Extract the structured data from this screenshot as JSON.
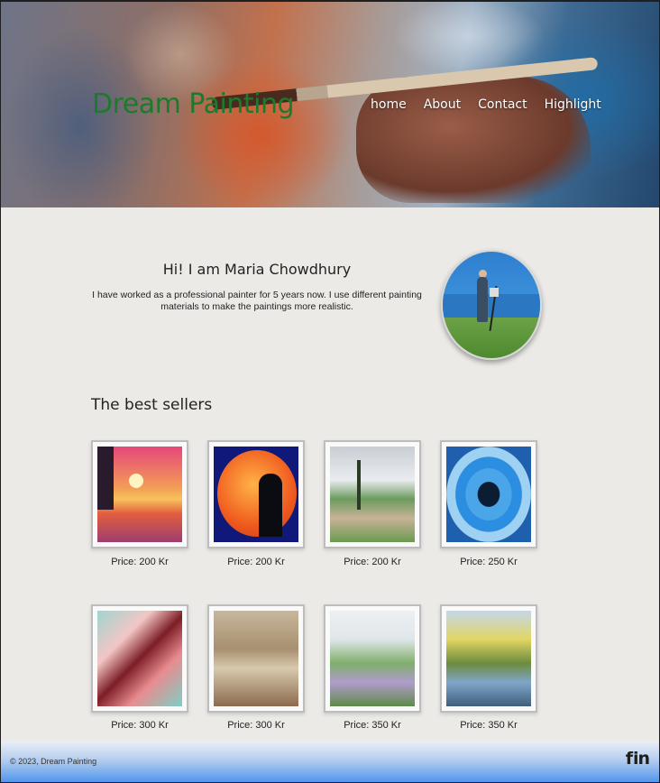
{
  "header": {
    "brand": "Dream Painting",
    "nav": [
      "home",
      "About",
      "Contact",
      "Highlight"
    ]
  },
  "intro": {
    "title": "Hi! I am Maria Chowdhury",
    "text": "I have worked as a professional painter for 5 years now. I use different painting materials to make the paintings more realistic."
  },
  "best_sellers": {
    "title": "The best sellers",
    "items": [
      {
        "price": "Price: 200 Kr"
      },
      {
        "price": "Price: 200 Kr"
      },
      {
        "price": "Price: 200 Kr"
      },
      {
        "price": "Price: 250 Kr"
      },
      {
        "price": "Price: 300 Kr"
      },
      {
        "price": "Price: 300 Kr"
      },
      {
        "price": "Price: 350 Kr"
      },
      {
        "price": "Price: 350 Kr"
      }
    ]
  },
  "footer": {
    "copyright": "© 2023, Dream Painting",
    "icons": [
      "facebook-icon",
      "linkedin-icon"
    ]
  }
}
